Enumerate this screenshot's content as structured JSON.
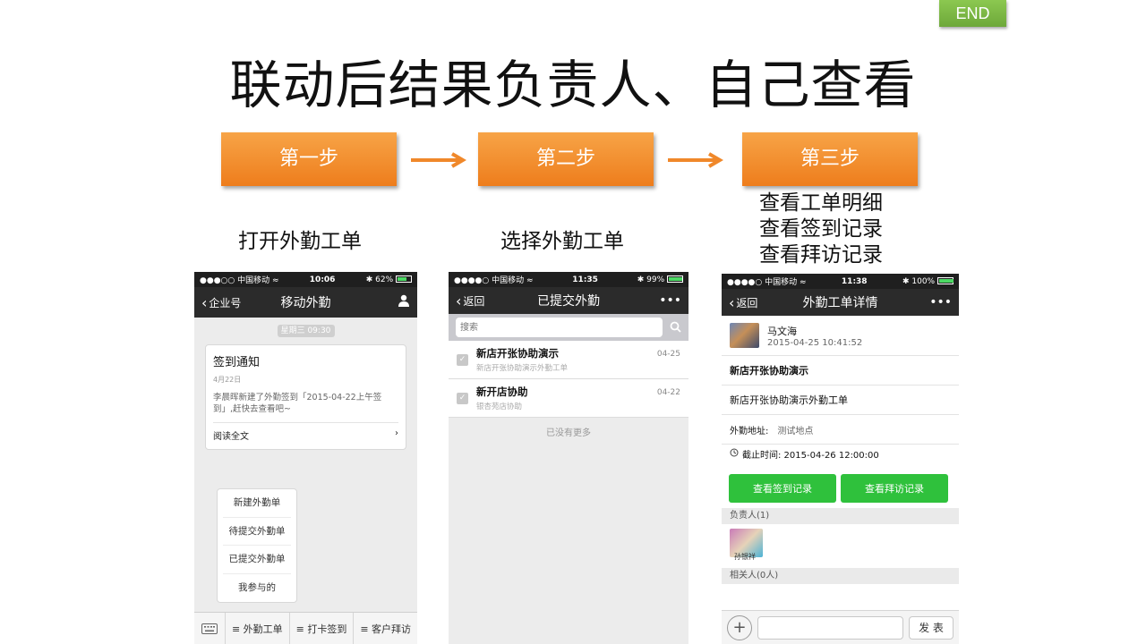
{
  "end_button": "END",
  "title": "联动后结果负责人、自己查看",
  "steps": [
    {
      "label": "第一步",
      "caption": "打开外勤工单"
    },
    {
      "label": "第二步",
      "caption": "选择外勤工单"
    },
    {
      "label": "第三步",
      "caption_lines": [
        "查看工单明细",
        "查看签到记录",
        "查看拜访记录"
      ]
    }
  ],
  "accent_colors": {
    "step": "#f0882a",
    "end": "#7bb946",
    "primary_green": "#2fc13c"
  },
  "phone1": {
    "status": {
      "carrier": "●●●○○ 中国移动 ≈",
      "time": "10:06",
      "battery": "✱ 62%"
    },
    "nav": {
      "back": "企业号",
      "title": "移动外勤",
      "right_icon": "person-icon"
    },
    "date_pill": "星期三 09:30",
    "card": {
      "title": "签到通知",
      "date": "4月22日",
      "body": "李晨晖新建了外勤签到「2015-04-22上午签到」,赶快去查看吧~",
      "read_more": "阅读全文"
    },
    "menu": [
      "新建外勤单",
      "待提交外勤单",
      "已提交外勤单",
      "我参与的"
    ],
    "tabs": [
      "≡ 外勤工单",
      "≡ 打卡签到",
      "≡ 客户拜访"
    ]
  },
  "phone2": {
    "status": {
      "carrier": "●●●●○ 中国移动 ≈",
      "time": "11:35",
      "battery": "✱ 99%"
    },
    "nav": {
      "back": "返回",
      "title": "已提交外勤",
      "right": "•••"
    },
    "search_placeholder": "搜索",
    "items": [
      {
        "title": "新店开张协助演示",
        "subtitle": "新店开张协助演示外勤工单",
        "date": "04-25"
      },
      {
        "title": "新开店协助",
        "subtitle": "银杏苑店协助",
        "date": "04-22"
      }
    ],
    "no_more": "已没有更多"
  },
  "phone3": {
    "status": {
      "carrier": "●●●●○ 中国移动 ≈",
      "time": "11:38",
      "battery": "✱ 100%"
    },
    "nav": {
      "back": "返回",
      "title": "外勤工单详情",
      "right": "•••"
    },
    "author": {
      "name": "马文海",
      "datetime": "2015-04-25 10:41:52"
    },
    "order_title": "新店开张协助演示",
    "order_desc": "新店开张协助演示外勤工单",
    "address_label": "外勤地址:",
    "address_value": "测试地点",
    "deadline": "截止时间: 2015-04-26 12:00:00",
    "btn_checkin": "查看签到记录",
    "btn_visit": "查看拜访记录",
    "owner_section": "负责人(1)",
    "owner_name": "孙银祥",
    "related_section": "相关人(0人)",
    "send": "发 表"
  }
}
